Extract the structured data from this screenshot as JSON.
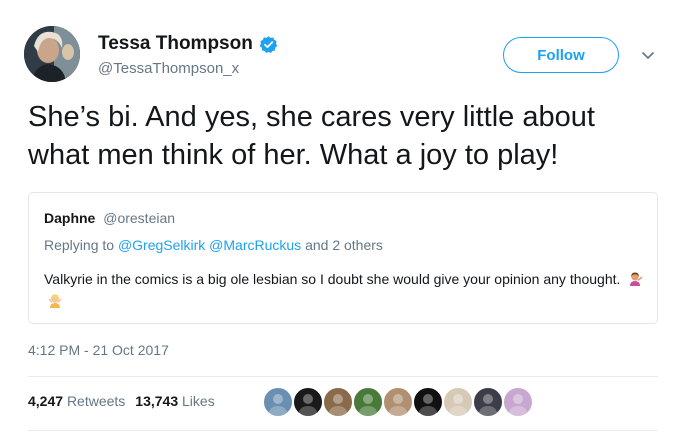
{
  "author": {
    "name": "Tessa Thompson",
    "handle": "@TessaThompson_x",
    "verified": true,
    "avatar_icon": "profile-photo"
  },
  "follow_button": {
    "label": "Follow"
  },
  "menu": {
    "icon": "chevron-down-icon"
  },
  "tweet": {
    "text": "She’s bi. And yes, she cares very little about what men think of her. What a joy to play!"
  },
  "quoted_tweet": {
    "author_name": "Daphne",
    "author_handle": "@oresteian",
    "reply_prefix": "Replying to",
    "reply_mention_1": "@GregSelkirk",
    "reply_mention_2": "@MarcRuckus",
    "reply_suffix": "and 2 others",
    "text": "Valkyrie in the comics is a big ole lesbian so I doubt she would give your opinion any thought.",
    "emojis": [
      "woman-gesturing-icon",
      "woman-blond-icon"
    ]
  },
  "timestamp": "4:12 PM - 21 Oct 2017",
  "stats": {
    "retweets_count": "4,247",
    "retweets_label": "Retweets",
    "likes_count": "13,743",
    "likes_label": "Likes"
  },
  "likers": [
    {
      "icon": "liker-avatar-1",
      "color": "#6a8fb0"
    },
    {
      "icon": "liker-avatar-2",
      "color": "#1a1a1a"
    },
    {
      "icon": "liker-avatar-3",
      "color": "#8a6a4a"
    },
    {
      "icon": "liker-avatar-4",
      "color": "#4a7a3a"
    },
    {
      "icon": "liker-avatar-5",
      "color": "#b09070"
    },
    {
      "icon": "liker-avatar-6",
      "color": "#111111"
    },
    {
      "icon": "liker-avatar-7",
      "color": "#d6c9b5"
    },
    {
      "icon": "liker-avatar-8",
      "color": "#3d3d4a"
    },
    {
      "icon": "liker-avatar-9",
      "color": "#c8a8d0"
    }
  ],
  "colors": {
    "accent": "#1da1f2",
    "text_primary": "#14171a",
    "text_secondary": "#657786",
    "border": "#e1e8ed"
  }
}
